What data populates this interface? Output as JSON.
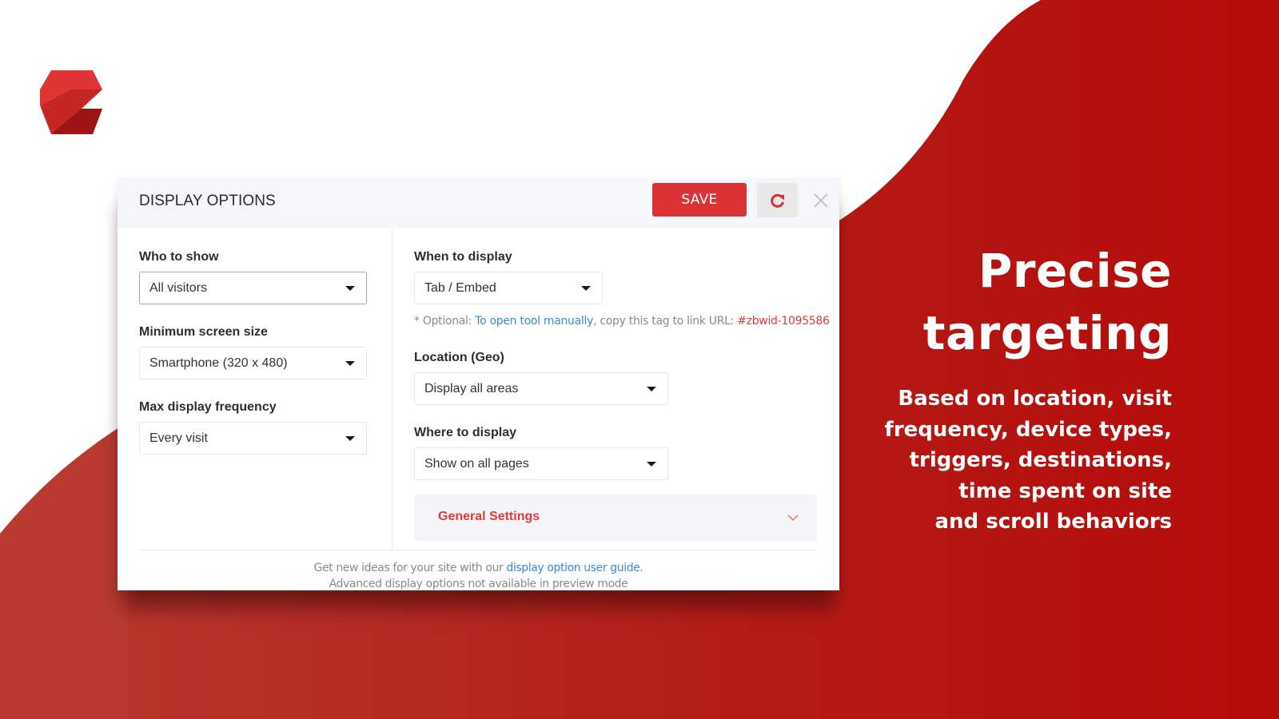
{
  "colors": {
    "brand_red": "#db3236",
    "bg_red_dark": "#b50f0d",
    "bg_red_light": "#b83a30",
    "link_blue": "#3a8ad6",
    "tag_red": "#e03a3a"
  },
  "logo": {
    "icon": "zotabox-z-logo"
  },
  "panel": {
    "title": "DISPLAY OPTIONS",
    "save_label": "SAVE",
    "refresh_icon": "refresh-icon",
    "close_icon": "close-icon",
    "left_column": {
      "who_to_show": {
        "label": "Who to show",
        "value": "All visitors"
      },
      "min_screen_size": {
        "label": "Minimum screen size",
        "value": "Smartphone (320 x 480)"
      },
      "max_frequency": {
        "label": "Max display frequency",
        "value": "Every visit"
      }
    },
    "right_column": {
      "when_to_display": {
        "label": "When to display",
        "value": "Tab / Embed"
      },
      "hint": {
        "prefix": "* Optional: ",
        "link": "To open tool manually",
        "middle": ", copy this tag to link URL: ",
        "tag": "#zbwid-1095586"
      },
      "location": {
        "label": "Location (Geo)",
        "value": "Display all areas"
      },
      "where_to_display": {
        "label": "Where to display",
        "value": "Show on all pages"
      },
      "general_settings": {
        "label": "General Settings"
      }
    },
    "footer": {
      "line1_prefix": "Get new ideas for your site with our ",
      "line1_link": "display option user guide",
      "line1_suffix": ".",
      "line2": "Advanced display options not available in preview mode"
    }
  },
  "promo": {
    "headline_line1": "Precise",
    "headline_line2": "targeting",
    "subtext": "Based on location, visit\nfrequency, device types,\ntriggers, destinations,\ntime spent on site\nand scroll behaviors"
  }
}
